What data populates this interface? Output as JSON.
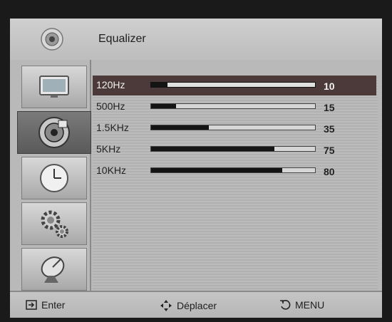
{
  "title": "Equalizer",
  "header_icon": "speaker-icon",
  "sidebar": {
    "items": [
      {
        "icon": "picture-monitor-icon",
        "active": false
      },
      {
        "icon": "speaker-icon",
        "active": true
      },
      {
        "icon": "clock-icon",
        "active": false
      },
      {
        "icon": "gears-icon",
        "active": false
      },
      {
        "icon": "satellite-dish-icon",
        "active": false
      }
    ]
  },
  "bands": [
    {
      "label": "120Hz",
      "value": "10",
      "level": 10,
      "selected": true
    },
    {
      "label": "500Hz",
      "value": "15",
      "level": 15,
      "selected": false
    },
    {
      "label": "1.5KHz",
      "value": "35",
      "level": 35,
      "selected": false
    },
    {
      "label": "5KHz",
      "value": "75",
      "level": 75,
      "selected": false
    },
    {
      "label": "10KHz",
      "value": "80",
      "level": 80,
      "selected": false
    }
  ],
  "footer": {
    "enter": "Enter",
    "move": "Déplacer",
    "menu": "MENU"
  },
  "colors": {
    "selected_row": "#4b3a39",
    "background": "#b9b9b9"
  }
}
